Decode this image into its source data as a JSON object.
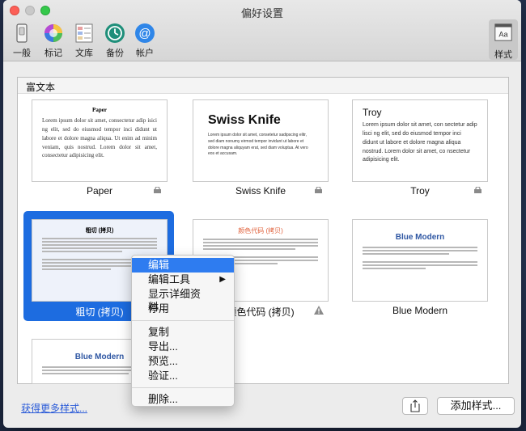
{
  "window": {
    "title": "偏好设置"
  },
  "toolbar": {
    "items": [
      {
        "label": "一般",
        "icon": "switch-icon"
      },
      {
        "label": "标记",
        "icon": "color-wheel-icon"
      },
      {
        "label": "文库",
        "icon": "library-icon"
      },
      {
        "label": "备份",
        "icon": "backup-icon"
      },
      {
        "label": "帐户",
        "icon": "at-icon"
      }
    ],
    "style_label": "样式",
    "style_icon_text": "Aa"
  },
  "section": {
    "title": "富文本"
  },
  "styles": [
    {
      "name": "Paper",
      "thumb_title": "Paper",
      "body": "Lorem ipsum dolor sit amet, consectetur adip isici ng elit, sed do eiusmod tempor inci didunt ut labore et dolore magna aliqua. Ut enim ad minim veniam, quis nostrud. Lorem dolor sit amet, consectetur adipisicing elit.",
      "locked": true
    },
    {
      "name": "Swiss Knife",
      "thumb_title": "Swiss Knife",
      "body": "Lorem ipsum dolor sit amet, consetetur sadipscing elitr, sed diam nonumy eirmod tempor invidunt ut labore et dolore magna aliquyam erat, sed diam voluptua. At vero eos et accusam.",
      "locked": true
    },
    {
      "name": "Troy",
      "thumb_title": "Troy",
      "body": "Lorem ipsum dolor sit amet, con sectetur adip lisci ng elit, sed do eiusmod tempor inci didunt ut labore et dolore magna aliqua nostrud. Lorem dolor sit amet, co nsectetur adipisicing elit.",
      "locked": true
    },
    {
      "name": "粗切 (拷贝)",
      "thumb_title": "粗切 (拷贝)",
      "selected": true
    },
    {
      "name": "颜色代码 (拷贝)",
      "thumb_title": "颜色代码 (拷贝)",
      "warning": true
    },
    {
      "name": "Blue Modern",
      "thumb_title": "Blue Modern"
    },
    {
      "name": "",
      "thumb_title": "Blue Modern"
    }
  ],
  "context_menu": {
    "items": [
      "编辑",
      "编辑工具",
      "显示详细资料...",
      "停用",
      "复制",
      "导出...",
      "预览...",
      "验证...",
      "删除..."
    ]
  },
  "footer": {
    "more_link": "获得更多样式...",
    "add_button": "添加样式..."
  },
  "colors": {
    "accent": "#1d6ce0",
    "menu_highlight": "#2e7cf0",
    "link": "#2a5bd8",
    "blue_modern": "#2f57a3"
  }
}
